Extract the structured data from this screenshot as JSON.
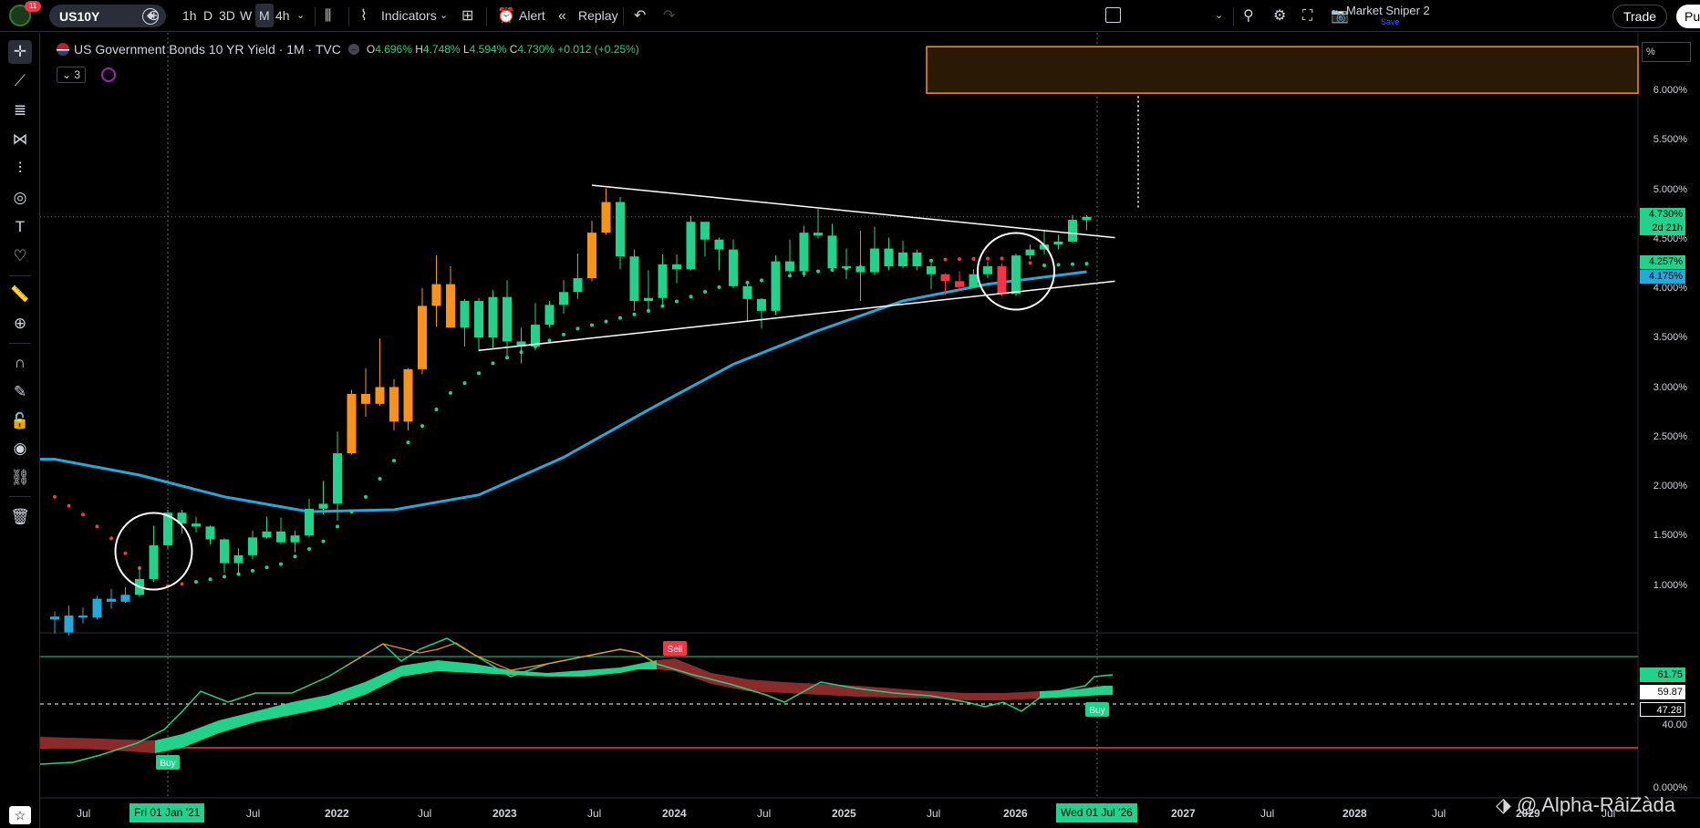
{
  "topbar": {
    "notifications": "11",
    "symbol": "US10Y",
    "timeframes": [
      "1h",
      "D",
      "3D",
      "W",
      "M",
      "4h"
    ],
    "active_timeframe": "M",
    "indicators_label": "Indicators",
    "alert_label": "Alert",
    "replay_label": "Replay",
    "layout_name": "Market Sniper 2",
    "save_label": "Save",
    "trade_label": "Trade",
    "publish_label": "Pu"
  },
  "legend": {
    "title": "US Government Bonds 10 YR Yield · 1M · TVC",
    "open_k": "O",
    "open": "4.696%",
    "high_k": "H",
    "high": "4.748%",
    "low_k": "L",
    "low": "4.594%",
    "close_k": "C",
    "close": "4.730%",
    "change": "+0.012 (+0.25%)",
    "indicator_count": "3"
  },
  "price_scale": {
    "unit": "%",
    "ticks": [
      "6.000%",
      "5.500%",
      "5.000%",
      "4.500%",
      "4.000%",
      "3.500%",
      "3.000%",
      "2.500%",
      "2.000%",
      "1.500%",
      "1.000%"
    ],
    "last_price": "4.730%",
    "countdown": "2d 21h",
    "label_green": "4.257%",
    "label_blue": "4.175%",
    "osc_ticks": [
      "40.00",
      "0.000%"
    ],
    "osc_labels": [
      "61.75",
      "59.87",
      "47.28"
    ]
  },
  "time_axis": {
    "labels": [
      "Jul",
      "Fri 01 Jan '21",
      "Jul",
      "2022",
      "Jul",
      "2023",
      "Jul",
      "2024",
      "Jul",
      "2025",
      "Jul",
      "2026",
      "Wed 01 Jul '26",
      "2027",
      "Jul",
      "2028",
      "Jul",
      "2029",
      "Jul"
    ]
  },
  "oscillator": {
    "sell_label": "Sell",
    "buy_label_1": "Buy",
    "buy_label_2": "Buy"
  },
  "watermark": "@ Alpha-RâiZàda",
  "chart_data": {
    "type": "candlestick",
    "title": "US Government Bonds 10 YR Yield · 1M · TVC",
    "xlabel": "",
    "ylabel": "",
    "ylim": [
      0.4,
      6.4
    ],
    "candles": [
      {
        "t": "2020-07",
        "o": 0.66,
        "h": 0.74,
        "l": 0.52,
        "c": 0.69
      },
      {
        "t": "2020-08",
        "o": 0.53,
        "h": 0.8,
        "l": 0.5,
        "c": 0.7
      },
      {
        "t": "2020-09",
        "o": 0.7,
        "h": 0.78,
        "l": 0.62,
        "c": 0.68
      },
      {
        "t": "2020-10",
        "o": 0.68,
        "h": 0.9,
        "l": 0.66,
        "c": 0.87
      },
      {
        "t": "2020-11",
        "o": 0.87,
        "h": 0.97,
        "l": 0.77,
        "c": 0.84
      },
      {
        "t": "2020-12",
        "o": 0.84,
        "h": 0.99,
        "l": 0.83,
        "c": 0.91
      },
      {
        "t": "2021-01",
        "o": 0.91,
        "h": 1.2,
        "l": 0.89,
        "c": 1.07
      },
      {
        "t": "2021-02",
        "o": 1.07,
        "h": 1.61,
        "l": 1.04,
        "c": 1.41
      },
      {
        "t": "2021-03",
        "o": 1.41,
        "h": 1.77,
        "l": 1.37,
        "c": 1.74
      },
      {
        "t": "2021-04",
        "o": 1.74,
        "h": 1.77,
        "l": 1.53,
        "c": 1.63
      },
      {
        "t": "2021-05",
        "o": 1.63,
        "h": 1.7,
        "l": 1.54,
        "c": 1.6
      },
      {
        "t": "2021-06",
        "o": 1.6,
        "h": 1.61,
        "l": 1.42,
        "c": 1.47
      },
      {
        "t": "2021-07",
        "o": 1.47,
        "h": 1.48,
        "l": 1.13,
        "c": 1.23
      },
      {
        "t": "2021-08",
        "o": 1.23,
        "h": 1.38,
        "l": 1.13,
        "c": 1.31
      },
      {
        "t": "2021-09",
        "o": 1.31,
        "h": 1.56,
        "l": 1.27,
        "c": 1.49
      },
      {
        "t": "2021-10",
        "o": 1.49,
        "h": 1.7,
        "l": 1.48,
        "c": 1.55
      },
      {
        "t": "2021-11",
        "o": 1.55,
        "h": 1.69,
        "l": 1.42,
        "c": 1.44
      },
      {
        "t": "2021-12",
        "o": 1.44,
        "h": 1.56,
        "l": 1.34,
        "c": 1.51
      },
      {
        "t": "2022-01",
        "o": 1.51,
        "h": 1.88,
        "l": 1.49,
        "c": 1.78
      },
      {
        "t": "2022-02",
        "o": 1.78,
        "h": 2.06,
        "l": 1.72,
        "c": 1.83
      },
      {
        "t": "2022-03",
        "o": 1.83,
        "h": 2.56,
        "l": 1.66,
        "c": 2.34
      },
      {
        "t": "2022-04",
        "o": 2.34,
        "h": 2.98,
        "l": 2.33,
        "c": 2.94
      },
      {
        "t": "2022-05",
        "o": 2.94,
        "h": 3.2,
        "l": 2.71,
        "c": 2.84
      },
      {
        "t": "2022-06",
        "o": 2.84,
        "h": 3.5,
        "l": 2.82,
        "c": 3.01
      },
      {
        "t": "2022-07",
        "o": 3.01,
        "h": 3.09,
        "l": 2.57,
        "c": 2.66
      },
      {
        "t": "2022-08",
        "o": 2.66,
        "h": 3.2,
        "l": 2.57,
        "c": 3.19
      },
      {
        "t": "2022-09",
        "o": 3.19,
        "h": 4.01,
        "l": 3.14,
        "c": 3.83
      },
      {
        "t": "2022-10",
        "o": 3.83,
        "h": 4.34,
        "l": 3.62,
        "c": 4.05
      },
      {
        "t": "2022-11",
        "o": 4.05,
        "h": 4.23,
        "l": 3.61,
        "c": 3.61
      },
      {
        "t": "2022-12",
        "o": 3.61,
        "h": 3.9,
        "l": 3.42,
        "c": 3.88
      },
      {
        "t": "2023-01",
        "o": 3.88,
        "h": 3.91,
        "l": 3.37,
        "c": 3.51
      },
      {
        "t": "2023-02",
        "o": 3.51,
        "h": 3.99,
        "l": 3.39,
        "c": 3.92
      },
      {
        "t": "2023-03",
        "o": 3.92,
        "h": 4.09,
        "l": 3.29,
        "c": 3.47
      },
      {
        "t": "2023-04",
        "o": 3.47,
        "h": 3.61,
        "l": 3.25,
        "c": 3.42
      },
      {
        "t": "2023-05",
        "o": 3.42,
        "h": 3.86,
        "l": 3.38,
        "c": 3.64
      },
      {
        "t": "2023-06",
        "o": 3.64,
        "h": 3.88,
        "l": 3.61,
        "c": 3.84
      },
      {
        "t": "2023-07",
        "o": 3.84,
        "h": 4.09,
        "l": 3.75,
        "c": 3.97
      },
      {
        "t": "2023-08",
        "o": 3.97,
        "h": 4.36,
        "l": 3.9,
        "c": 4.11
      },
      {
        "t": "2023-09",
        "o": 4.11,
        "h": 4.69,
        "l": 4.08,
        "c": 4.57
      },
      {
        "t": "2023-10",
        "o": 4.57,
        "h": 5.02,
        "l": 4.55,
        "c": 4.88
      },
      {
        "t": "2023-11",
        "o": 4.88,
        "h": 4.93,
        "l": 4.2,
        "c": 4.33
      },
      {
        "t": "2023-12",
        "o": 4.33,
        "h": 4.4,
        "l": 3.78,
        "c": 3.88
      },
      {
        "t": "2024-01",
        "o": 3.88,
        "h": 4.19,
        "l": 3.78,
        "c": 3.91
      },
      {
        "t": "2024-02",
        "o": 3.91,
        "h": 4.35,
        "l": 3.85,
        "c": 4.25
      },
      {
        "t": "2024-03",
        "o": 4.25,
        "h": 4.35,
        "l": 4.06,
        "c": 4.2
      },
      {
        "t": "2024-04",
        "o": 4.2,
        "h": 4.74,
        "l": 4.19,
        "c": 4.68
      },
      {
        "t": "2024-05",
        "o": 4.68,
        "h": 4.64,
        "l": 4.33,
        "c": 4.5
      },
      {
        "t": "2024-06",
        "o": 4.5,
        "h": 4.52,
        "l": 4.19,
        "c": 4.4
      },
      {
        "t": "2024-07",
        "o": 4.4,
        "h": 4.5,
        "l": 4.01,
        "c": 4.03
      },
      {
        "t": "2024-08",
        "o": 4.03,
        "h": 4.05,
        "l": 3.67,
        "c": 3.9
      },
      {
        "t": "2024-09",
        "o": 3.9,
        "h": 3.91,
        "l": 3.6,
        "c": 3.78
      },
      {
        "t": "2024-10",
        "o": 3.78,
        "h": 4.34,
        "l": 3.74,
        "c": 4.28
      },
      {
        "t": "2024-11",
        "o": 4.28,
        "h": 4.5,
        "l": 4.15,
        "c": 4.18
      },
      {
        "t": "2024-12",
        "o": 4.18,
        "h": 4.64,
        "l": 4.12,
        "c": 4.57
      },
      {
        "t": "2025-01",
        "o": 4.57,
        "h": 4.81,
        "l": 4.51,
        "c": 4.54
      },
      {
        "t": "2025-02",
        "o": 4.54,
        "h": 4.66,
        "l": 4.21,
        "c": 4.21
      },
      {
        "t": "2025-03",
        "o": 4.21,
        "h": 4.41,
        "l": 4.1,
        "c": 4.23
      },
      {
        "t": "2025-04",
        "o": 4.23,
        "h": 4.59,
        "l": 3.88,
        "c": 4.17
      },
      {
        "t": "2025-05",
        "o": 4.17,
        "h": 4.63,
        "l": 4.14,
        "c": 4.41
      },
      {
        "t": "2025-06",
        "o": 4.41,
        "h": 4.52,
        "l": 4.19,
        "c": 4.23
      },
      {
        "t": "2025-07",
        "o": 4.23,
        "h": 4.49,
        "l": 4.21,
        "c": 4.37
      },
      {
        "t": "2025-08",
        "o": 4.37,
        "h": 4.4,
        "l": 4.19,
        "c": 4.23
      },
      {
        "t": "2025-09",
        "o": 4.23,
        "h": 4.27,
        "l": 4.0,
        "c": 4.15
      },
      {
        "t": "2025-10",
        "o": 4.15,
        "h": 4.16,
        "l": 3.94,
        "c": 4.08
      },
      {
        "t": "2025-11",
        "o": 4.08,
        "h": 4.18,
        "l": 3.99,
        "c": 4.02
      },
      {
        "t": "2025-12",
        "o": 4.02,
        "h": 4.2,
        "l": 4.01,
        "c": 4.15
      },
      {
        "t": "2026-01",
        "o": 4.15,
        "h": 4.28,
        "l": 4.11,
        "c": 4.23
      },
      {
        "t": "2026-02",
        "o": 4.23,
        "h": 4.26,
        "l": 3.93,
        "c": 3.95
      },
      {
        "t": "2026-03",
        "o": 3.95,
        "h": 4.36,
        "l": 3.93,
        "c": 4.34
      },
      {
        "t": "2026-04",
        "o": 4.34,
        "h": 4.45,
        "l": 4.3,
        "c": 4.4
      },
      {
        "t": "2026-05",
        "o": 4.4,
        "h": 4.6,
        "l": 4.35,
        "c": 4.45
      },
      {
        "t": "2026-06",
        "o": 4.45,
        "h": 4.55,
        "l": 4.4,
        "c": 4.48
      },
      {
        "t": "2026-07",
        "o": 4.48,
        "h": 4.75,
        "l": 4.47,
        "c": 4.7
      },
      {
        "t": "2026-08",
        "o": 4.696,
        "h": 4.748,
        "l": 4.594,
        "c": 4.73
      }
    ],
    "moving_average": [
      {
        "t": "2020-07",
        "v": 2.28
      },
      {
        "t": "2021-01",
        "v": 2.12
      },
      {
        "t": "2021-07",
        "v": 1.9
      },
      {
        "t": "2022-01",
        "v": 1.75
      },
      {
        "t": "2022-07",
        "v": 1.77
      },
      {
        "t": "2023-01",
        "v": 1.92
      },
      {
        "t": "2023-07",
        "v": 2.3
      },
      {
        "t": "2024-01",
        "v": 2.78
      },
      {
        "t": "2024-07",
        "v": 3.24
      },
      {
        "t": "2025-01",
        "v": 3.58
      },
      {
        "t": "2025-07",
        "v": 3.88
      },
      {
        "t": "2026-01",
        "v": 4.05
      },
      {
        "t": "2026-08",
        "v": 4.175
      }
    ],
    "parabolic_sar": [
      {
        "t": "2020-07",
        "v": 1.9,
        "trend": "down"
      },
      {
        "t": "2020-09",
        "v": 1.72,
        "trend": "down"
      },
      {
        "t": "2020-11",
        "v": 1.48,
        "trend": "down"
      },
      {
        "t": "2021-01",
        "v": 1.18,
        "trend": "down"
      },
      {
        "t": "2021-03",
        "v": 1.0,
        "trend": "down"
      },
      {
        "t": "2021-05",
        "v": 1.04,
        "trend": "up"
      },
      {
        "t": "2021-08",
        "v": 1.12,
        "trend": "up"
      },
      {
        "t": "2021-11",
        "v": 1.22,
        "trend": "up"
      },
      {
        "t": "2022-02",
        "v": 1.45,
        "trend": "up"
      },
      {
        "t": "2022-05",
        "v": 1.9,
        "trend": "up"
      },
      {
        "t": "2022-08",
        "v": 2.45,
        "trend": "up"
      },
      {
        "t": "2022-11",
        "v": 2.95,
        "trend": "up"
      },
      {
        "t": "2023-02",
        "v": 3.25,
        "trend": "up"
      },
      {
        "t": "2023-05",
        "v": 3.42,
        "trend": "up"
      },
      {
        "t": "2023-08",
        "v": 3.6,
        "trend": "up"
      },
      {
        "t": "2024-01",
        "v": 3.78,
        "trend": "up"
      },
      {
        "t": "2024-06",
        "v": 4.02,
        "trend": "up"
      },
      {
        "t": "2025-01",
        "v": 4.18,
        "trend": "up"
      },
      {
        "t": "2025-06",
        "v": 4.25,
        "trend": "up"
      },
      {
        "t": "2025-10",
        "v": 4.3,
        "trend": "down"
      },
      {
        "t": "2026-02",
        "v": 4.31,
        "trend": "down"
      },
      {
        "t": "2026-05",
        "v": 4.24,
        "trend": "up"
      },
      {
        "t": "2026-08",
        "v": 4.257,
        "trend": "up"
      }
    ],
    "trendlines": [
      {
        "name": "upper",
        "from": {
          "t": "2023-09",
          "v": 5.05
        },
        "to": {
          "t": "2026-10",
          "v": 4.52
        }
      },
      {
        "name": "lower",
        "from": {
          "t": "2023-01",
          "v": 3.38
        },
        "to": {
          "t": "2026-10",
          "v": 4.08
        }
      }
    ],
    "target_zone": {
      "v_top": 6.45,
      "v_bottom": 5.98
    },
    "last_price": 4.73,
    "oscillator": {
      "levels": [
        70,
        47.28,
        30
      ],
      "values_labels": [
        61.75,
        59.87,
        47.28
      ]
    }
  }
}
